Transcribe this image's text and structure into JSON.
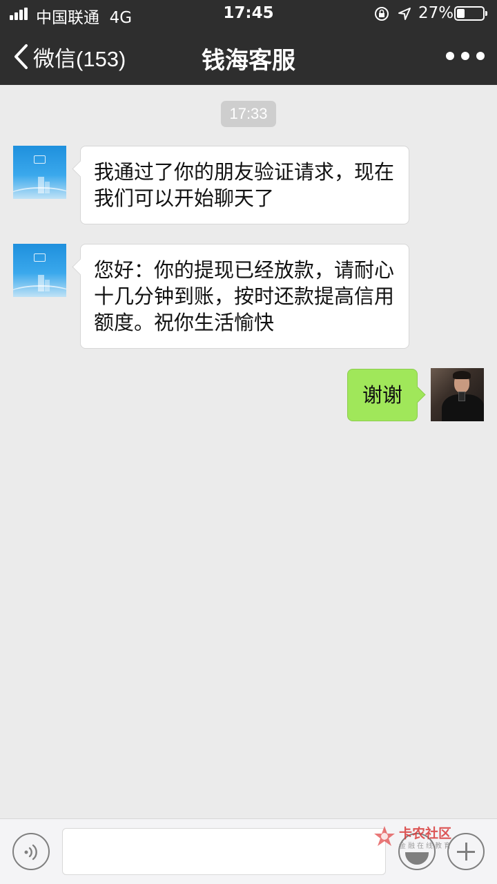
{
  "status_bar": {
    "carrier": "中国联通",
    "network": "4G",
    "time": "17:45",
    "battery": "27%",
    "battery_level": 0.27
  },
  "nav": {
    "back_label": "微信(153)",
    "title": "钱海客服",
    "icons": {
      "back": "chevron-left-icon",
      "more": "more-dots-icon"
    }
  },
  "chat": {
    "timestamp": "17:33",
    "messages": [
      {
        "side": "left",
        "text": "我通过了你的朋友验证请求，现在我们可以开始聊天了"
      },
      {
        "side": "left",
        "text": "您好：你的提现已经放款，请耐心十几分钟到账，按时还款提高信用额度。祝你生活愉快"
      },
      {
        "side": "right",
        "text": "谢谢"
      }
    ]
  },
  "input_bar": {
    "icons": {
      "voice": "voice-icon",
      "emoji": "emoji-icon",
      "plus": "plus-icon"
    },
    "value": ""
  },
  "watermark": {
    "title": "卡农社区",
    "subtitle": "金融在线教育"
  },
  "colors": {
    "header_bg": "#2e2e2e",
    "chat_bg": "#ebebeb",
    "outgoing_bubble": "#a0e75a",
    "incoming_bubble": "#ffffff"
  }
}
